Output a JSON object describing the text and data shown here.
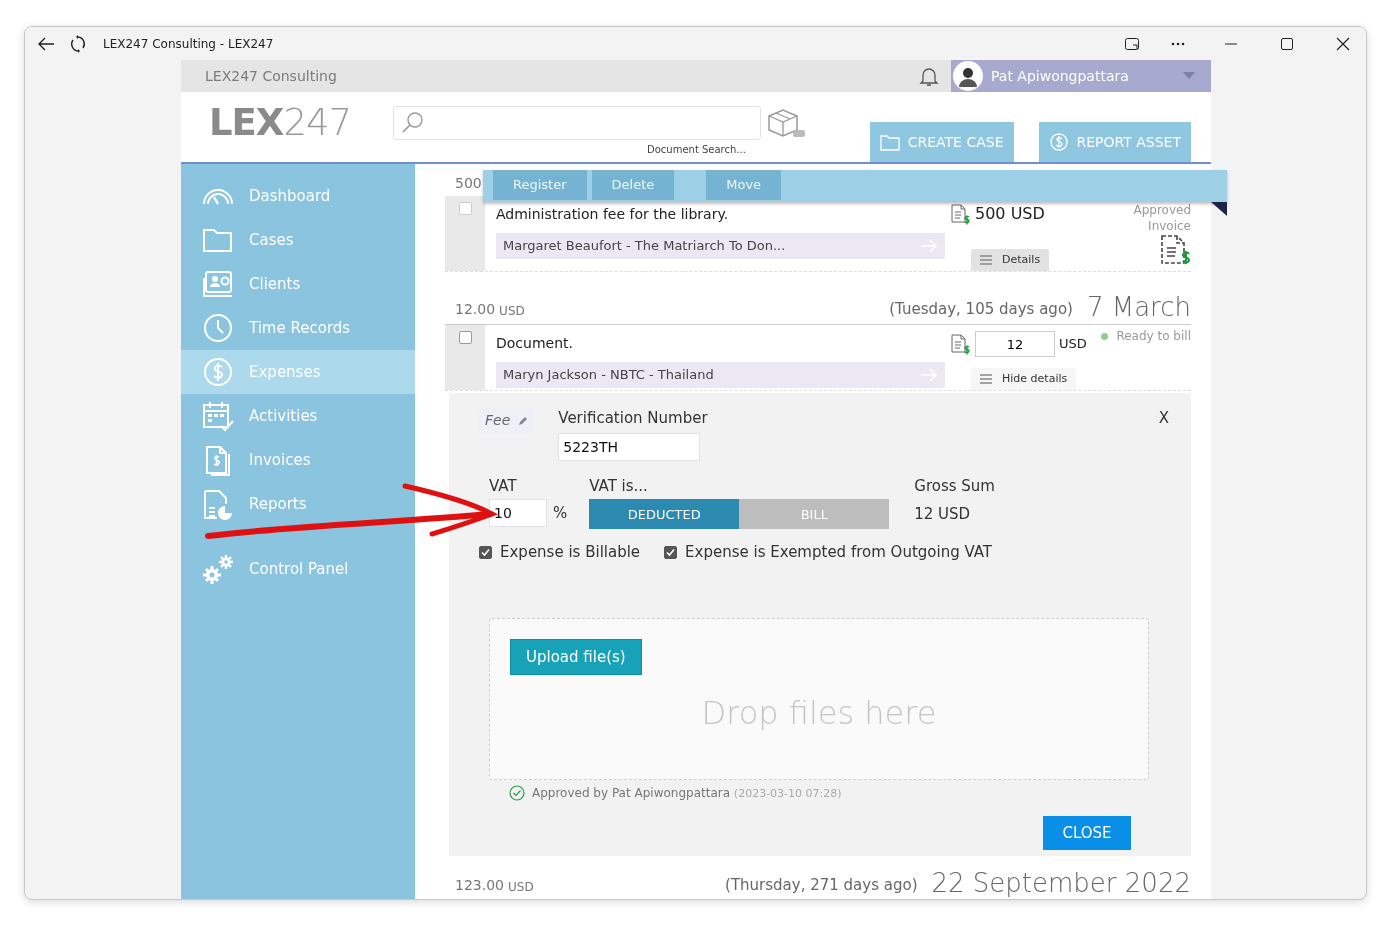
{
  "browser": {
    "title": "LEX247 Consulting - LEX247"
  },
  "app": {
    "company": "LEX247 Consulting",
    "user": "Pat Apiwongpattara",
    "logo": {
      "letters": "LEX",
      "digits": "247"
    },
    "search": {
      "caption": "Document Search..."
    },
    "actions": [
      "CREATE CASE",
      "REPORT ASSET"
    ]
  },
  "sidebar": {
    "items": [
      {
        "label": "Dashboard",
        "selected": false
      },
      {
        "label": "Cases",
        "selected": false
      },
      {
        "label": "Clients",
        "selected": false
      },
      {
        "label": "Time Records",
        "selected": false
      },
      {
        "label": "Expenses",
        "selected": true
      },
      {
        "label": "Activities",
        "selected": false
      },
      {
        "label": "Invoices",
        "selected": false
      },
      {
        "label": "Reports",
        "selected": false
      }
    ],
    "bottom_items": [
      {
        "label": "Control Panel",
        "selected": false
      }
    ]
  },
  "toolbar": {
    "buttons": [
      {
        "label": "Register",
        "disabled": true
      },
      {
        "label": "Delete",
        "disabled": true
      },
      {
        "label": "Move",
        "disabled": true
      }
    ]
  },
  "entries": [
    {
      "kind": "header",
      "amount": "500"
    },
    {
      "kind": "expense",
      "checked": false,
      "description": "Administration fee for the library.",
      "matter": "Margaret Beaufort - The Matriarch To Don...",
      "amount": {
        "kind": "text",
        "value": "500 USD"
      },
      "status": {
        "kind": "invoice",
        "lines": [
          "Approved",
          "Invoice"
        ]
      },
      "toggle": "Details",
      "expanded": false
    },
    {
      "kind": "header",
      "amount": "12.00",
      "currency": "USD",
      "relative": "(Tuesday, 105 days ago)",
      "date": "7 March"
    },
    {
      "kind": "expense",
      "checked": false,
      "description": "Document.",
      "matter": "Maryn Jackson - NBTC - Thailand",
      "amount": {
        "kind": "input",
        "value": "12",
        "currency": "USD"
      },
      "status": {
        "kind": "dot",
        "label": "Ready to bill",
        "color": "#8fcf8f"
      },
      "toggle": "Hide details",
      "expanded": true
    },
    {
      "kind": "details",
      "tag": "Fee",
      "verification_label": "Verification Number",
      "verification_value": "5223TH",
      "dismiss": "X",
      "vat_label": "VAT",
      "vat_value": "10",
      "percent": "%",
      "vat_is_label": "VAT is...",
      "vat_options": [
        {
          "label": "DEDUCTED",
          "selected": true
        },
        {
          "label": "BILL",
          "selected": false
        }
      ],
      "gross_label": "Gross Sum",
      "gross_value": "12 USD",
      "checks": [
        {
          "label": "Expense is Billable",
          "checked": true
        },
        {
          "label": "Expense is Exempted from Outgoing VAT",
          "checked": true
        }
      ],
      "upload": "Upload file(s)",
      "drop": "Drop files here",
      "approved_by": "Approved by Pat Apiwongpattara",
      "approved_at": "(2023-03-10 07:28)",
      "close": "CLOSE"
    },
    {
      "kind": "header",
      "amount": "123.00",
      "currency": "USD",
      "relative": "(Thursday, 271 days ago)",
      "date": "22 September 2022"
    }
  ]
}
